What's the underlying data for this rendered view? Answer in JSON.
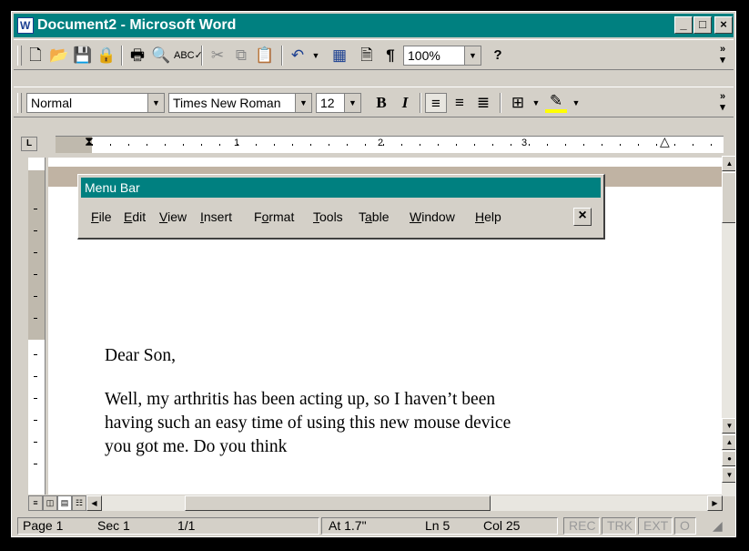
{
  "window": {
    "title": "Document2 - Microsoft Word"
  },
  "title_buttons": {
    "minimize": "_",
    "maximize": "□",
    "close": "×"
  },
  "toolbar_standard": {
    "zoom": "100%",
    "icons": [
      "new-icon",
      "open-icon",
      "save-icon",
      "permission-icon",
      "print-icon",
      "print-preview-icon",
      "spelling-icon",
      "cut-icon",
      "copy-icon",
      "paste-icon",
      "undo-icon",
      "table-icon",
      "document-map-icon",
      "show-formatting-icon",
      "help-icon"
    ]
  },
  "toolbar_formatting": {
    "style": "Normal",
    "font": "Times New Roman",
    "size": "12",
    "bold": "B",
    "italic": "I"
  },
  "ruler": {
    "numbers": [
      "1",
      "2",
      "3"
    ]
  },
  "menubar": {
    "title": "Menu Bar",
    "items": [
      {
        "pre": "",
        "key": "F",
        "post": "ile"
      },
      {
        "pre": "",
        "key": "E",
        "post": "dit"
      },
      {
        "pre": "",
        "key": "V",
        "post": "iew"
      },
      {
        "pre": "",
        "key": "I",
        "post": "nsert"
      },
      {
        "pre": "F",
        "key": "o",
        "post": "rmat"
      },
      {
        "pre": "",
        "key": "T",
        "post": "ools"
      },
      {
        "pre": "T",
        "key": "a",
        "post": "ble"
      },
      {
        "pre": "",
        "key": "W",
        "post": "indow"
      },
      {
        "pre": "",
        "key": "H",
        "post": "elp"
      }
    ]
  },
  "document": {
    "lines": [
      "Dear Son,",
      "Well, my arthritis has been acting up, so I haven’t been",
      "having such an easy time of using this new mouse device",
      "you got me. Do you think"
    ]
  },
  "status": {
    "page": "Page 1",
    "sec": "Sec 1",
    "pages": "1/1",
    "at": "At 1.7\"",
    "ln": "Ln 5",
    "col": "Col 25",
    "rec": "REC",
    "trk": "TRK",
    "ext": "EXT",
    "ovr": "O"
  }
}
